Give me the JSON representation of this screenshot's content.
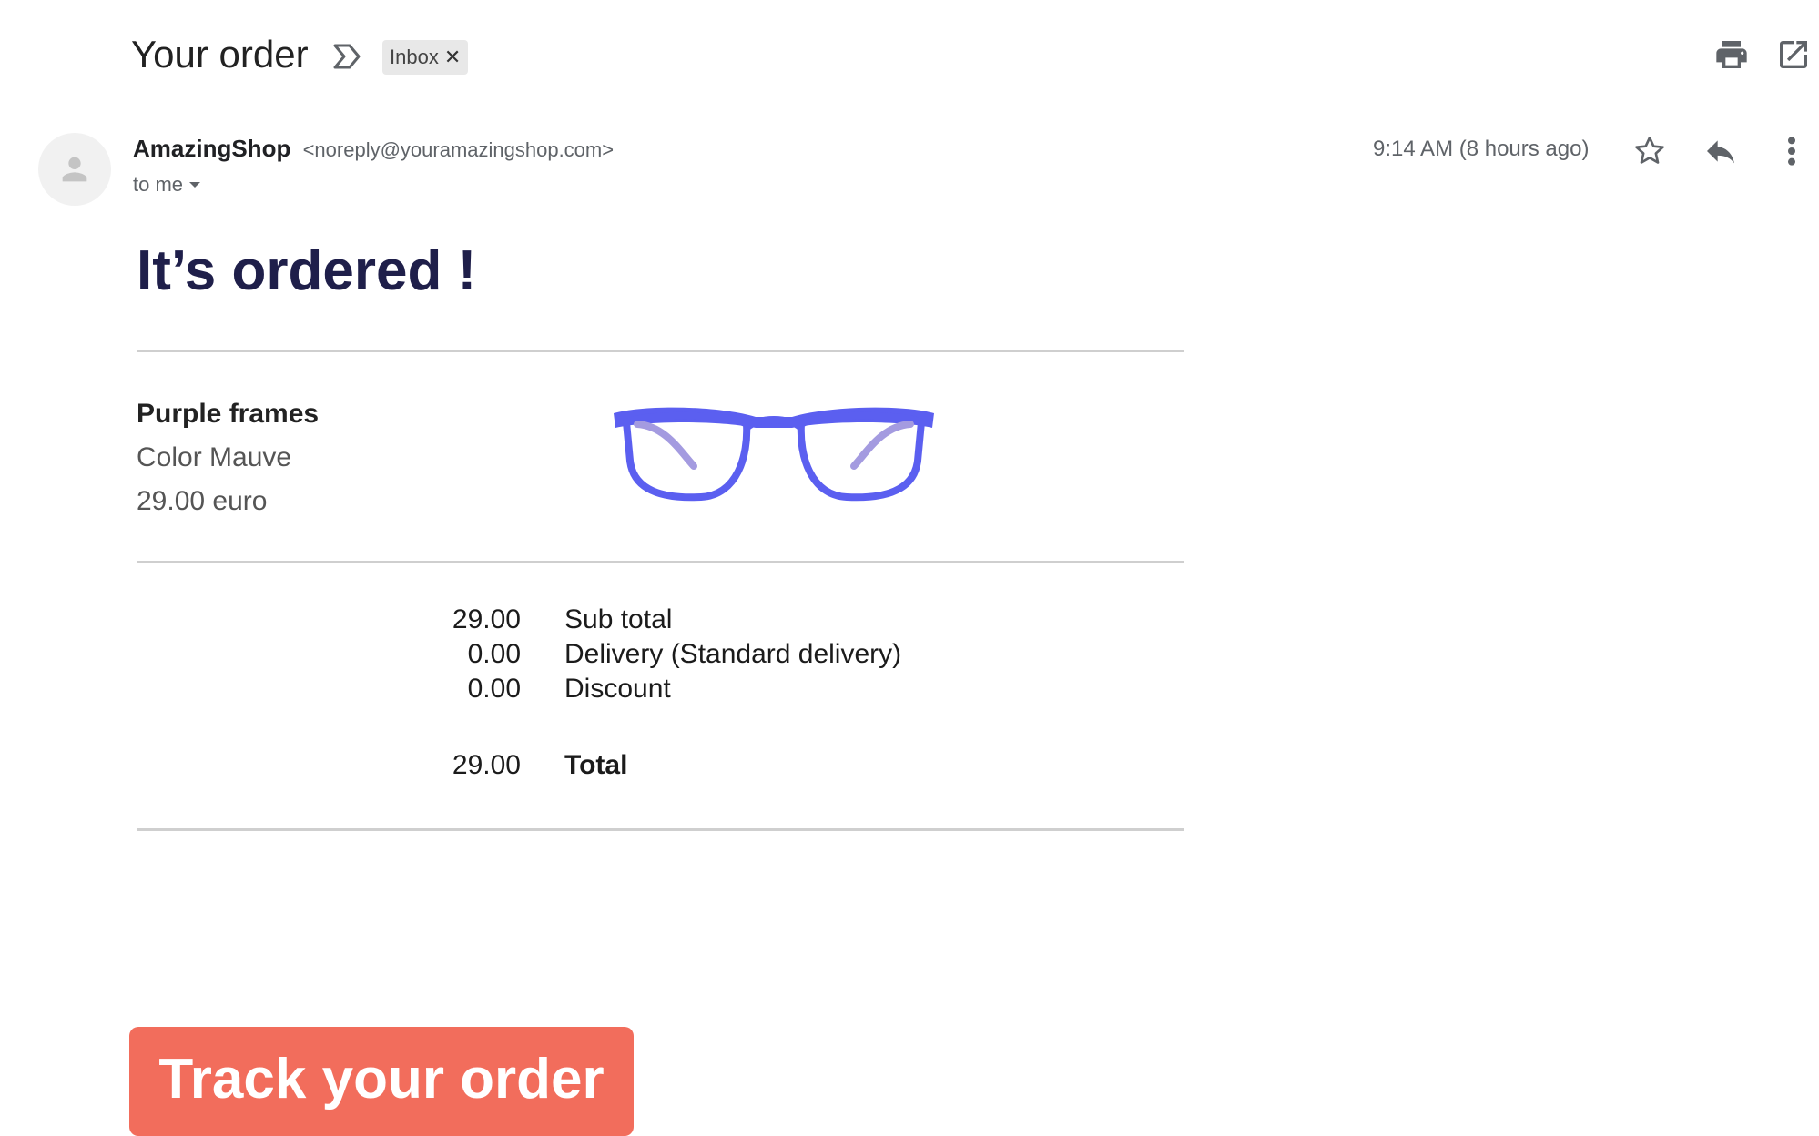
{
  "header": {
    "subject": "Your order",
    "label_chip": "Inbox",
    "label_remove_glyph": "✕",
    "icons": [
      "importance-marker-icon",
      "print-icon",
      "open-in-new-window-icon"
    ]
  },
  "message": {
    "sender_name": "AmazingShop",
    "sender_email": "<noreply@youramazingshop.com>",
    "recipient": "to me",
    "timestamp": "9:14 AM (8 hours ago)",
    "action_icons": [
      "star-icon",
      "reply-icon",
      "more-vert-icon"
    ]
  },
  "email_body": {
    "headline": "It’s ordered !",
    "product": {
      "name": "Purple frames",
      "color": "Color Mauve",
      "price": "29.00 euro",
      "image": "glasses-image",
      "frame_color": "#5b5ff0"
    },
    "totals": [
      {
        "amount": "29.00",
        "label": "Sub total"
      },
      {
        "amount": "0.00",
        "label": "Delivery (Standard delivery)"
      },
      {
        "amount": "0.00",
        "label": "Discount"
      }
    ],
    "grand_total": {
      "amount": "29.00",
      "label": "Total"
    },
    "cta_label": "Track your order",
    "cta_color": "#f26d5c",
    "headline_color": "#1f1f4a"
  }
}
